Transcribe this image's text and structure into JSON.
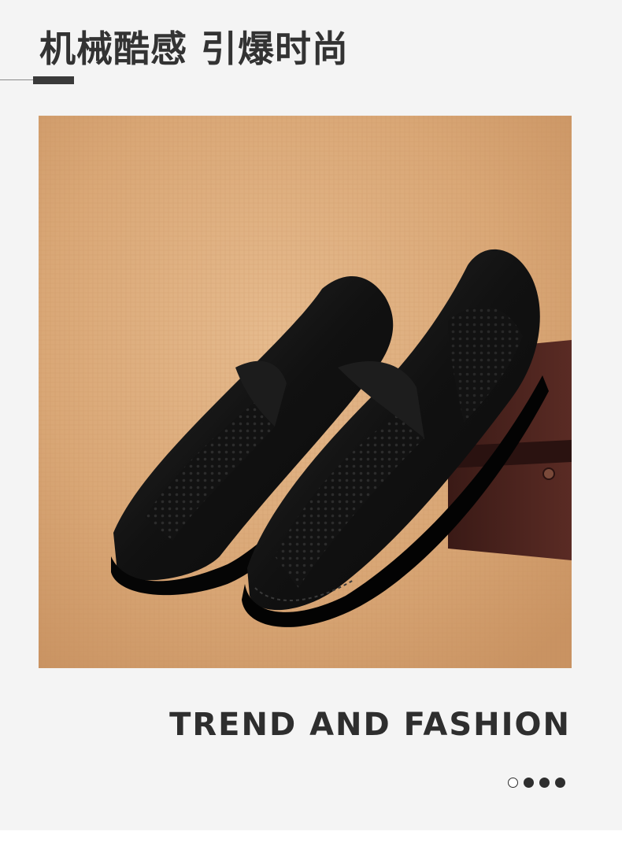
{
  "header": {
    "title": "机械酷感 引爆时尚"
  },
  "photo": {
    "subject": "black-loafers-image",
    "background_color": "#d9a97a"
  },
  "tagline": {
    "text": "TREND AND FASHION"
  },
  "pager": {
    "count": 4,
    "active_index": 0
  },
  "colors": {
    "page_bg": "#f4f4f4",
    "text": "#333333",
    "accent_bar": "#3a3a3a"
  }
}
